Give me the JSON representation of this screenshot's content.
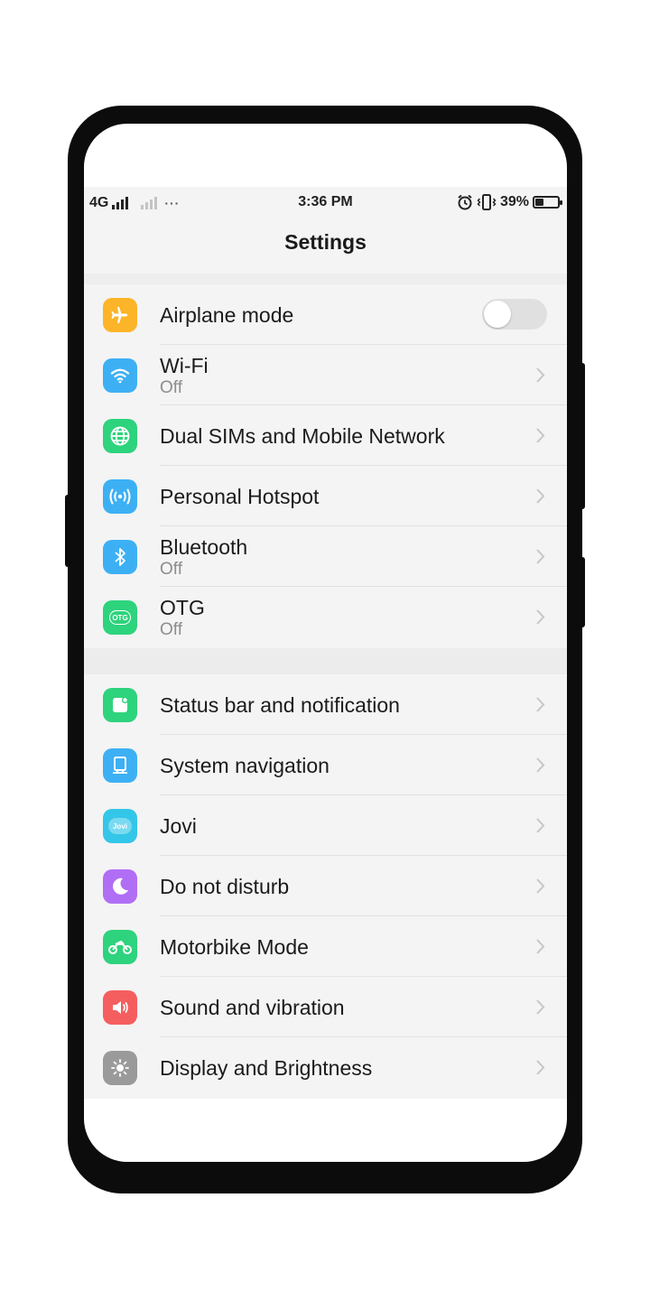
{
  "status_bar": {
    "network": "4G",
    "time": "3:36 PM",
    "battery_percent": "39%",
    "battery_level": 0.39,
    "overflow": "···"
  },
  "header": {
    "title": "Settings"
  },
  "colors": {
    "airplane": "#fcb528",
    "wifi": "#3db0f4",
    "dual_sim": "#2ed37d",
    "hotspot": "#3db0f4",
    "bluetooth": "#3db0f4",
    "otg": "#2ed37d",
    "status_bar_icon": "#2ed37d",
    "system_nav": "#3db0f4",
    "jovi": "#34c6e8",
    "dnd": "#b06ef5",
    "motorbike": "#2ed37d",
    "sound": "#f55e5e",
    "display": "#9a9a9a"
  },
  "group_1": [
    {
      "label": "Airplane mode",
      "icon": "airplane-icon",
      "toggle": false
    },
    {
      "label": "Wi-Fi",
      "sub": "Off",
      "icon": "wifi-icon"
    },
    {
      "label": "Dual SIMs and Mobile Network",
      "icon": "globe-icon"
    },
    {
      "label": "Personal Hotspot",
      "icon": "hotspot-icon"
    },
    {
      "label": "Bluetooth",
      "sub": "Off",
      "icon": "bluetooth-icon"
    },
    {
      "label": "OTG",
      "sub": "Off",
      "icon": "otg-icon",
      "icon_text": "OTG"
    }
  ],
  "group_2": [
    {
      "label": "Status bar and notification",
      "icon": "notification-icon"
    },
    {
      "label": "System navigation",
      "icon": "navigation-icon"
    },
    {
      "label": "Jovi",
      "icon": "jovi-icon",
      "icon_text": "Jovi"
    },
    {
      "label": "Do not disturb",
      "icon": "moon-icon"
    },
    {
      "label": "Motorbike Mode",
      "icon": "motorbike-icon"
    },
    {
      "label": "Sound and vibration",
      "icon": "speaker-icon"
    },
    {
      "label": "Display and Brightness",
      "icon": "brightness-icon"
    }
  ]
}
